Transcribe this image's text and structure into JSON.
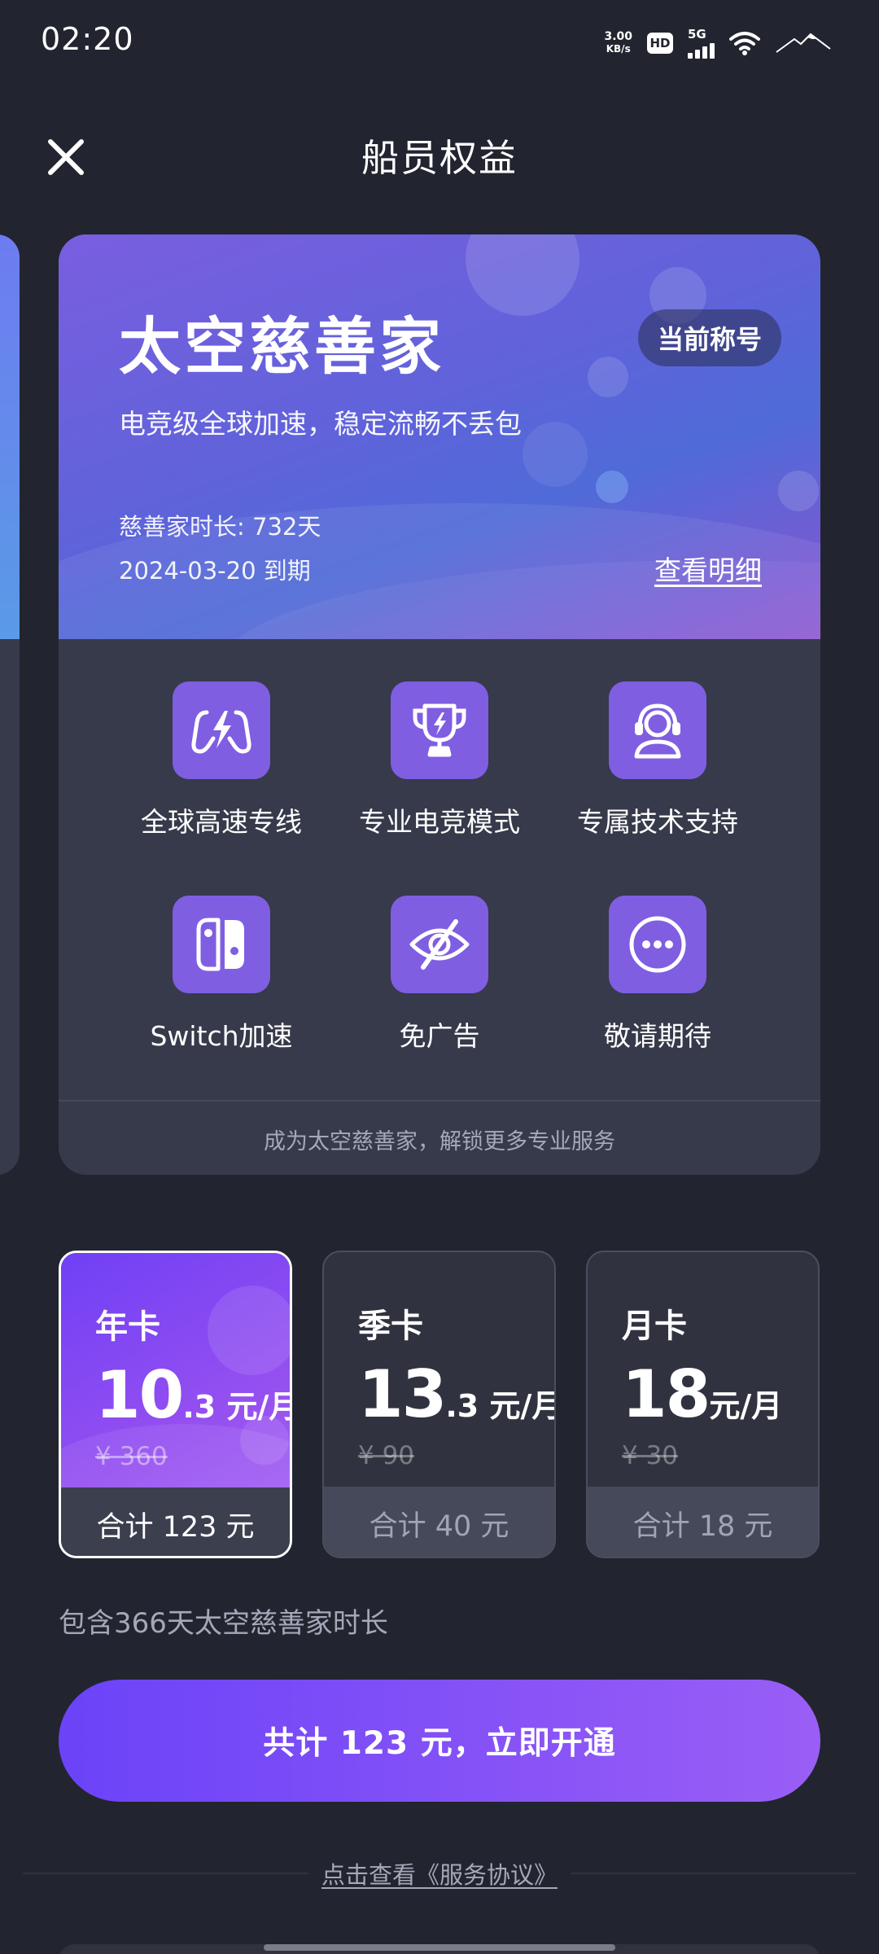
{
  "status_bar": {
    "time": "02:20",
    "speed_value": "3.00",
    "speed_unit": "KB/s",
    "hd_label": "HD",
    "network_label": "5G",
    "icons": [
      "hd-icon",
      "signal-icon",
      "wifi-icon",
      "mountain-icon"
    ]
  },
  "header": {
    "title": "船员权益",
    "close_icon": "close-icon"
  },
  "card": {
    "title": "太空慈善家",
    "badge": "当前称号",
    "subtitle": "电竞级全球加速，稳定流畅不丢包",
    "duration": "慈善家时长: 732天",
    "expire": "2024-03-20 到期",
    "detail_link": "查看明细",
    "benefits": [
      {
        "label": "全球高速专线",
        "icon": "gamepad-lightning-icon"
      },
      {
        "label": "专业电竞模式",
        "icon": "trophy-icon"
      },
      {
        "label": "专属技术支持",
        "icon": "headset-support-icon"
      },
      {
        "label": "Switch加速",
        "icon": "switch-console-icon"
      },
      {
        "label": "免广告",
        "icon": "eye-off-icon"
      },
      {
        "label": "敬请期待",
        "icon": "more-dots-icon"
      }
    ],
    "footer": "成为太空慈善家，解锁更多专业服务"
  },
  "plans": [
    {
      "name": "年卡",
      "price_int": "10",
      "price_dec": ".3",
      "unit": " 元/月",
      "original": "¥ 360",
      "total": "合计 123 元",
      "selected": true
    },
    {
      "name": "季卡",
      "price_int": "13",
      "price_dec": ".3",
      "unit": " 元/月",
      "original": "¥ 90",
      "total": "合计 40 元",
      "selected": false
    },
    {
      "name": "月卡",
      "price_int": "18",
      "price_dec": "",
      "unit": "元/月",
      "original": "¥ 30",
      "total": "合计 18 元",
      "selected": false
    }
  ],
  "plan_desc": "包含366天太空慈善家时长",
  "cta": "共计 123 元，立即开通",
  "agreement": "点击查看《服务协议》",
  "colors": {
    "background": "#22252f",
    "card": "#363a4a",
    "accent": "#7f5ee2",
    "cta_start": "#6b43f8",
    "cta_end": "#9a5ef6"
  }
}
